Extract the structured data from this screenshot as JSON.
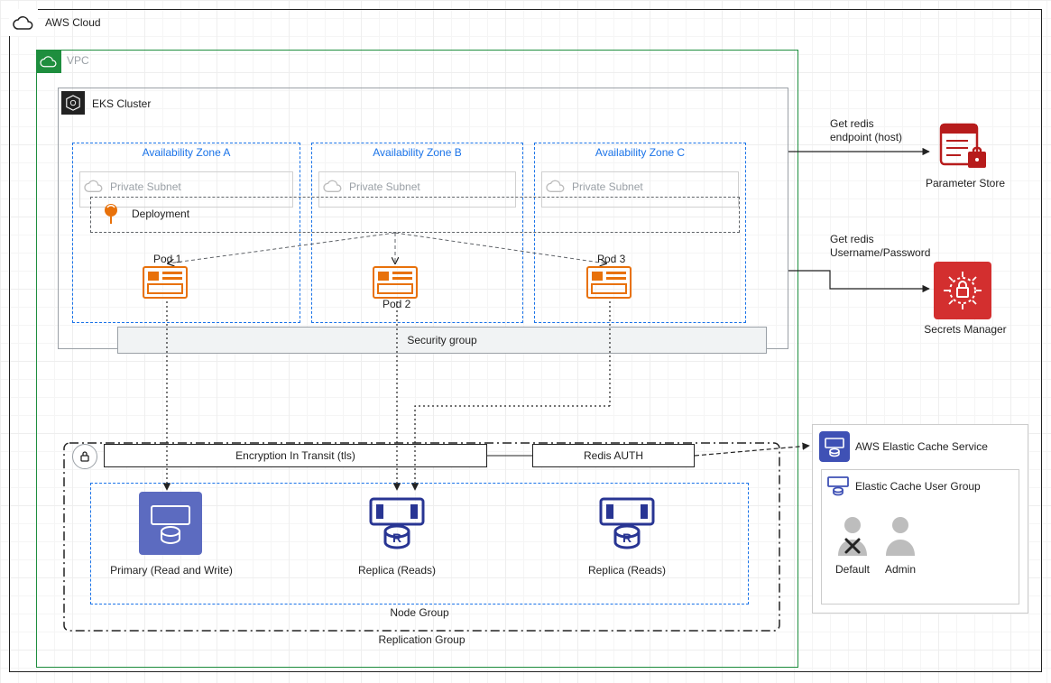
{
  "cloud": {
    "title": "AWS Cloud"
  },
  "vpc": {
    "title": "VPC"
  },
  "eks": {
    "title": "EKS Cluster"
  },
  "azs": {
    "a": {
      "title": "Availability Zone A",
      "subnet": "Private Subnet",
      "pod": "Pod 1"
    },
    "b": {
      "title": "Availability Zone B",
      "subnet": "Private Subnet",
      "pod": "Pod 2"
    },
    "c": {
      "title": "Availability Zone C",
      "subnet": "Private Subnet",
      "pod": "Pod 3"
    }
  },
  "deployment": {
    "label": "Deployment"
  },
  "security_group": {
    "label": "Security group"
  },
  "encryption": {
    "label": "Encryption In Transit (tls)"
  },
  "redis_auth": {
    "label": "Redis AUTH"
  },
  "node_group": {
    "label": "Node Group"
  },
  "replication_group": {
    "label": "Replication Group"
  },
  "cache_nodes": {
    "primary": "Primary (Read and Write)",
    "replica1": "Replica (Reads)",
    "replica2": "Replica (Reads)"
  },
  "param_store": {
    "label": "Parameter Store",
    "edge": "Get redis\nendpoint (host)"
  },
  "secrets": {
    "label": "Secrets Manager",
    "edge": "Get redis\nUsername/Password"
  },
  "ecs": {
    "title": "AWS Elastic Cache Service",
    "group": "Elastic Cache User Group",
    "users": {
      "default": "Default",
      "admin": "Admin"
    }
  },
  "colors": {
    "blue_dashed": "#1a73e8",
    "green": "#1e8e3e",
    "orange": "#e8710a",
    "grey": "#9aa0a6",
    "darkgrey": "#5f6368",
    "red": "#c5221f",
    "indigo": "#3f51b5",
    "violet": "#7e57c2"
  }
}
